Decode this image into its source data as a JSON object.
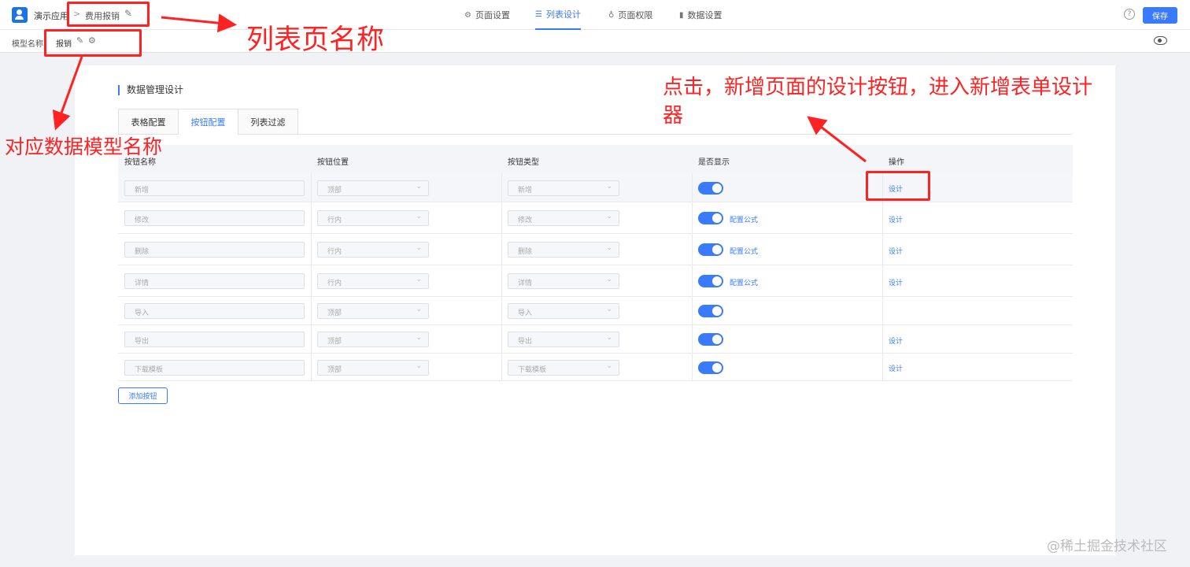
{
  "header": {
    "app_name": "演示应用",
    "breadcrumb_arrow": ">",
    "page_name": "费用报销",
    "nav": [
      {
        "label": "页面设置",
        "icon": "gear-icon"
      },
      {
        "label": "列表设计",
        "icon": "list-icon",
        "active": true
      },
      {
        "label": "页面权限",
        "icon": "lock-icon"
      },
      {
        "label": "数据设置",
        "icon": "bar-chart-icon"
      }
    ],
    "help_label": "?",
    "save_label": "保存"
  },
  "subbar": {
    "model_label": "模型名称：",
    "model_value": "报销"
  },
  "card": {
    "title": "数据管理设计",
    "tabs": [
      {
        "label": "表格配置"
      },
      {
        "label": "按钮配置",
        "active": true
      },
      {
        "label": "列表过滤"
      }
    ],
    "columns": [
      "按钮名称",
      "按钮位置",
      "按钮类型",
      "是否显示",
      "操作"
    ],
    "rows": [
      {
        "name": "新增",
        "position": "顶部",
        "type": "新增",
        "shown": true,
        "formula": "",
        "action": "设计"
      },
      {
        "name": "修改",
        "position": "行内",
        "type": "修改",
        "shown": true,
        "formula": "配置公式",
        "action": "设计"
      },
      {
        "name": "删除",
        "position": "行内",
        "type": "删除",
        "shown": true,
        "formula": "配置公式",
        "action": "设计"
      },
      {
        "name": "详情",
        "position": "行内",
        "type": "详情",
        "shown": true,
        "formula": "配置公式",
        "action": "设计"
      },
      {
        "name": "导入",
        "position": "顶部",
        "type": "导入",
        "shown": true,
        "formula": "",
        "action": ""
      },
      {
        "name": "导出",
        "position": "顶部",
        "type": "导出",
        "shown": true,
        "formula": "",
        "action": "设计"
      },
      {
        "name": "下载模板",
        "position": "顶部",
        "type": "下载模板",
        "shown": true,
        "formula": "",
        "action": "设计"
      }
    ],
    "add_button_label": "添加按钮"
  },
  "annotations": {
    "list_page_name": "列表页名称",
    "model_name": "对应数据模型名称",
    "instruction_line1": "点击，新增页面的设计按钮，进入新增表单设计",
    "instruction_line2": "器"
  },
  "watermark": "@稀土掘金技术社区",
  "colors": {
    "accent": "#3a7afe",
    "annotation": "#ff2222"
  }
}
